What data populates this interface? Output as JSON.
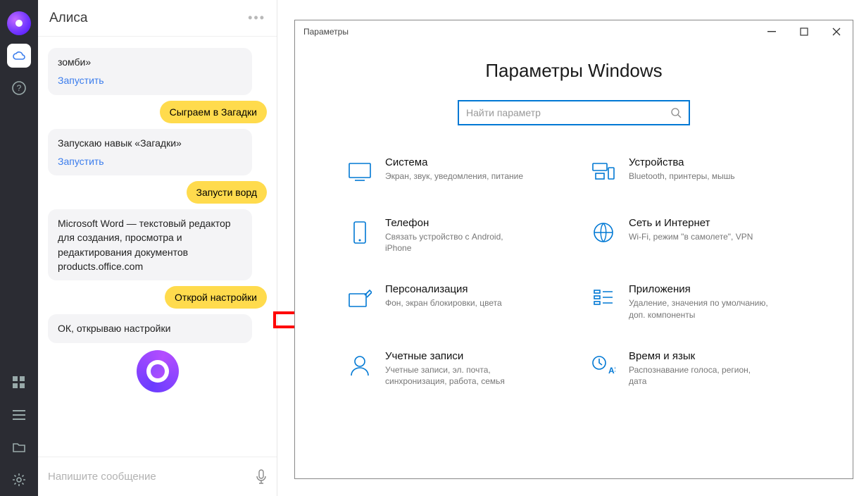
{
  "alice": {
    "title": "Алиса",
    "messages": {
      "m0_text": "зомби»",
      "m0_action": "Запустить",
      "m1_out": "Сыграем в Загадки",
      "m2_text": "Запускаю навык «Загадки»",
      "m2_action": "Запустить",
      "m3_out": "Запусти ворд",
      "m4_text": "Microsoft Word — текстовый редактор для создания, просмотра и редактирования документов products.office.com",
      "m5_out": "Открой настройки",
      "m6_text": "ОК, открываю настройки"
    },
    "input_placeholder": "Напишите сообщение"
  },
  "settings": {
    "window_title": "Параметры",
    "heading": "Параметры Windows",
    "search_placeholder": "Найти параметр",
    "tiles": {
      "system": {
        "title": "Система",
        "sub": "Экран, звук, уведомления, питание"
      },
      "devices": {
        "title": "Устройства",
        "sub": "Bluetooth, принтеры, мышь"
      },
      "phone": {
        "title": "Телефон",
        "sub": "Связать устройство с Android, iPhone"
      },
      "network": {
        "title": "Сеть и Интернет",
        "sub": "Wi-Fi, режим \"в самолете\", VPN"
      },
      "personalization": {
        "title": "Персонализация",
        "sub": "Фон, экран блокировки, цвета"
      },
      "apps": {
        "title": "Приложения",
        "sub": "Удаление, значения по умолчанию, доп. компоненты"
      },
      "accounts": {
        "title": "Учетные записи",
        "sub": "Учетные записи, эл. почта, синхронизация, работа, семья"
      },
      "time": {
        "title": "Время и язык",
        "sub": "Распознавание голоса, регион, дата"
      }
    }
  }
}
